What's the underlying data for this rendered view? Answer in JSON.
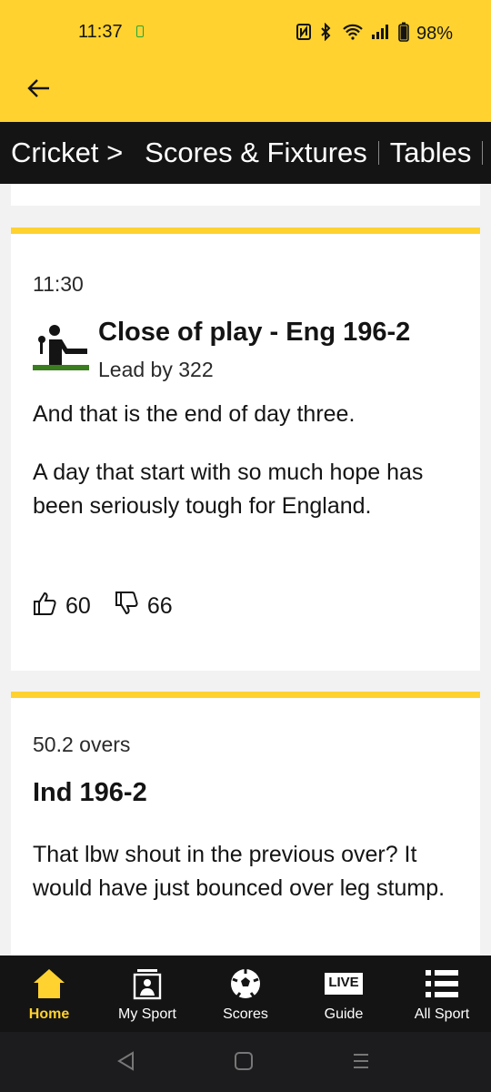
{
  "status": {
    "time": "11:37",
    "battery": "98%",
    "icons": [
      "nfc-icon",
      "bluetooth-icon",
      "wifi-icon",
      "signal-icon",
      "battery-icon"
    ]
  },
  "nav": {
    "items": [
      "Cricket >",
      "Scores & Fixtures",
      "Tables"
    ]
  },
  "entries": [
    {
      "stamp": "11:30",
      "headline": "Close of play - Eng 196-2",
      "subline": "Lead by 322",
      "paragraphs": [
        "And that is the end of day three.",
        "A day that start with so much hope has been seriously tough for England."
      ],
      "likes": "60",
      "dislikes": "66"
    },
    {
      "stamp": "50.2 overs",
      "headline": "Ind 196-2",
      "paragraphs": [
        "That lbw shout in the previous over? It would have just bounced over leg stump."
      ]
    }
  ],
  "bottom_nav": {
    "items": [
      {
        "label": "Home",
        "icon": "home-icon",
        "active": true
      },
      {
        "label": "My Sport",
        "icon": "my-sport-icon"
      },
      {
        "label": "Scores",
        "icon": "football-icon"
      },
      {
        "label": "Guide",
        "icon": "live-icon",
        "badge": "LIVE"
      },
      {
        "label": "All Sport",
        "icon": "menu-list-icon"
      }
    ]
  },
  "colors": {
    "accent": "#ffd230",
    "dark": "#141414",
    "cricket_green": "#3a7d1e"
  }
}
